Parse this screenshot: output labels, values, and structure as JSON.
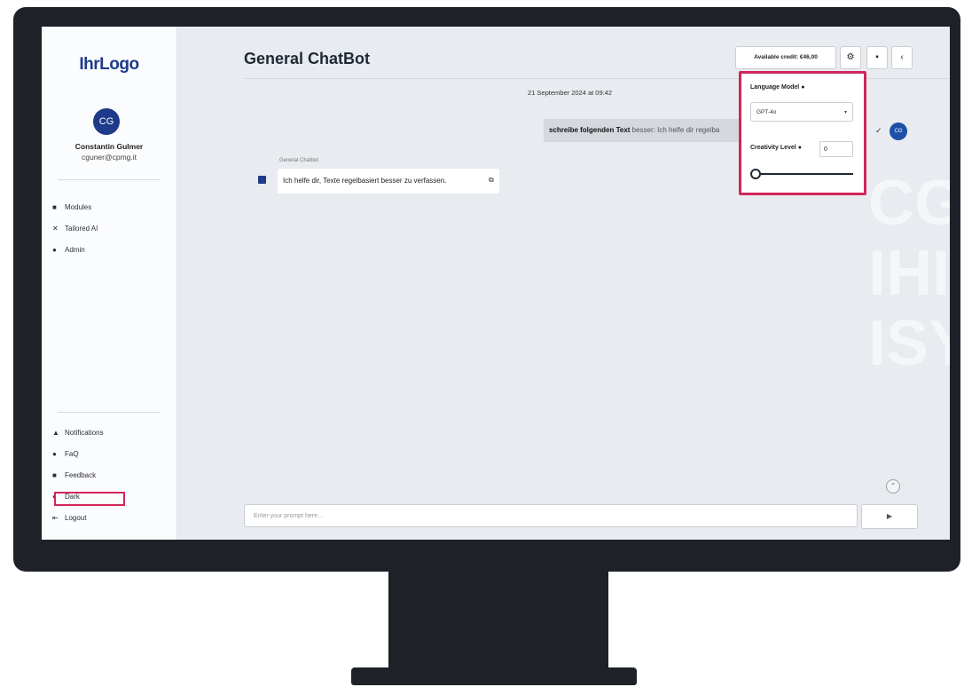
{
  "sidebar": {
    "logo": "IhrLogo",
    "avatar_initials": "CG",
    "user_name": "Constantin Gulmer",
    "user_email": "cguner@cpmg.it",
    "nav_top": [
      {
        "label": "Modules",
        "icon": "modules-icon",
        "glyph": "■"
      },
      {
        "label": "Tailored AI",
        "icon": "tools-icon",
        "glyph": "✕"
      },
      {
        "label": "Admin",
        "icon": "admin-icon",
        "glyph": "●"
      }
    ],
    "nav_bottom": [
      {
        "label": "Notifications",
        "icon": "bell-icon",
        "glyph": "▲"
      },
      {
        "label": "FaQ",
        "icon": "question-icon",
        "glyph": "●"
      },
      {
        "label": "Feedback",
        "icon": "feedback-icon",
        "glyph": "■"
      },
      {
        "label": "Dark",
        "icon": "moon-icon",
        "glyph": "◐"
      },
      {
        "label": "Logout",
        "icon": "logout-icon",
        "glyph": "⇤"
      }
    ]
  },
  "main": {
    "title": "General ChatBot",
    "credit": "Available credit: €46,00",
    "date": "21 September 2024 at 09:42",
    "user_message_bold": "schreibe folgenden Text",
    "user_message_rest": " besser: Ich helfe dir regelba",
    "bot_label": "General Chatbot",
    "bot_message": "Ich helfe dir, Texte regelbasiert besser zu verfassen.",
    "prompt_placeholder": "Enter your prompt here...",
    "send_glyph": "▶",
    "watermark_text": "CG\nIHIDIG\nISY"
  },
  "settings": {
    "language_model_label": "Language Model",
    "language_model_value": "GPT-4o",
    "creativity_label": "Creativity Level",
    "creativity_value": "0"
  },
  "colors": {
    "accent": "#1e3a8a",
    "highlight": "#d1265a",
    "screen_bg": "#e8ebef",
    "bezel": "#1e2228"
  }
}
